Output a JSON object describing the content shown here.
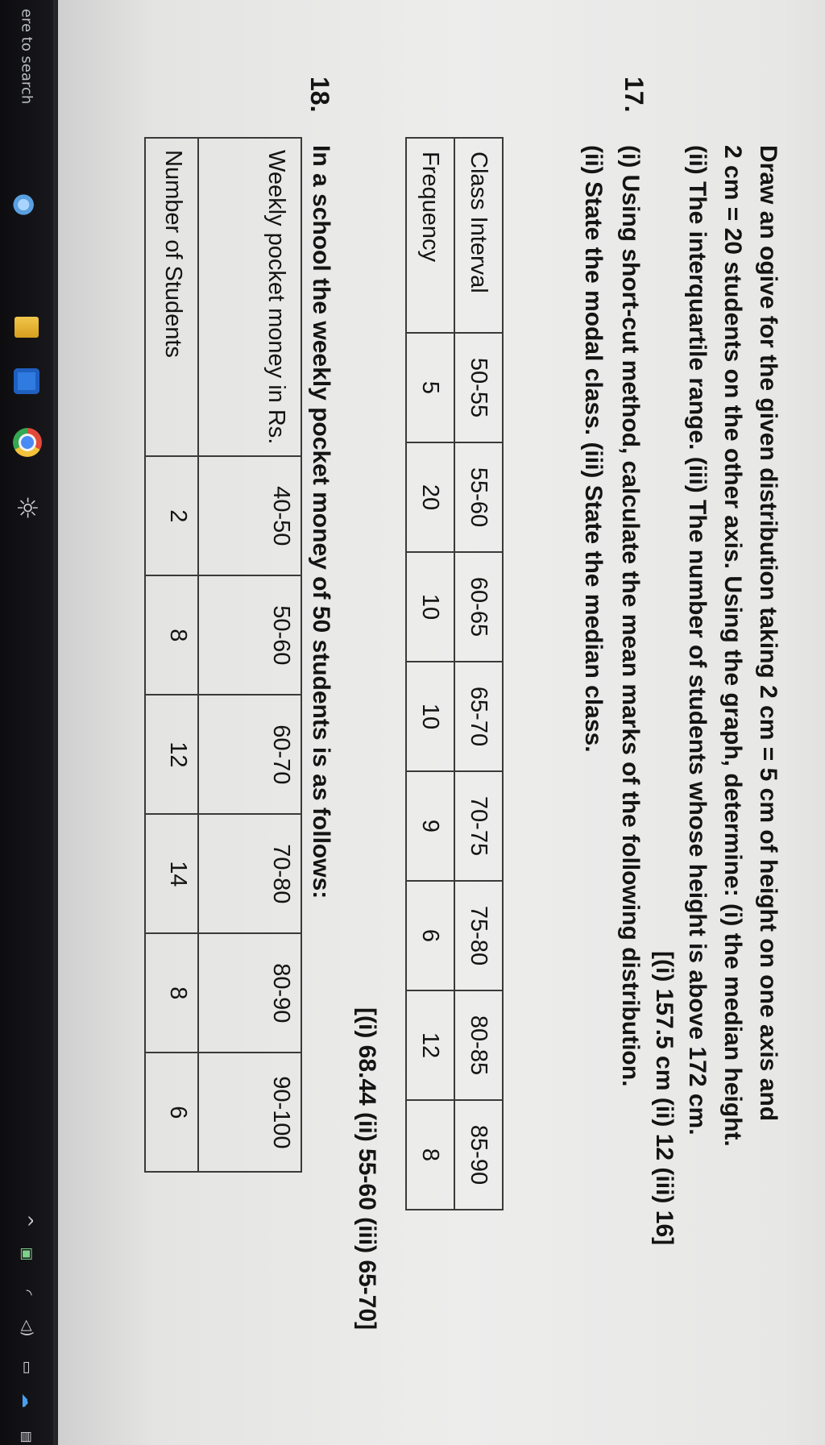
{
  "taskbar": {
    "search_label": "ere to search",
    "icons": [
      "tray-icon",
      "file-explorer-icon",
      "store-icon",
      "chrome-icon",
      "settings-icon",
      "chevron-up-icon",
      "tray-app-icon",
      "wifi-icon",
      "volume-icon",
      "battery-icon",
      "cloud-icon",
      "notification-icon"
    ]
  },
  "q16": {
    "lines": [
      "Draw an ogive for the given distribution taking 2 cm = 5 cm of height on one axis and",
      "2 cm = 20 students on the other axis. Using the graph, determine: (i) the median height.",
      "(ii) The interquartile range. (iii) The number of students whose height is above 172 cm."
    ],
    "answer": "[(i) 157.5 cm (ii) 12 (iii) 16]"
  },
  "q17": {
    "number": "17.",
    "lines": [
      "(i) Using short-cut method, calculate the mean marks of the following distribution.",
      "(ii) State the modal class. (iii) State the median class."
    ],
    "table": {
      "row_headers": [
        "Class Interval",
        "Frequency"
      ],
      "intervals": [
        "50-55",
        "55-60",
        "60-65",
        "65-70",
        "70-75",
        "75-80",
        "80-85",
        "85-90"
      ],
      "frequencies": [
        "5",
        "20",
        "10",
        "10",
        "9",
        "6",
        "12",
        "8"
      ]
    },
    "answer": "[(i) 68.44 (ii) 55-60 (iii) 65-70]"
  },
  "q18": {
    "number": "18.",
    "text": "In a school the weekly pocket money of 50 students is as follows:",
    "table": {
      "row_headers": [
        "Weekly pocket money in Rs.",
        "Number of Students"
      ],
      "money": [
        "40-50",
        "50-60",
        "60-70",
        "70-80",
        "80-90",
        "90-100"
      ],
      "students": [
        "2",
        "8",
        "12",
        "14",
        "8",
        "6"
      ]
    }
  }
}
